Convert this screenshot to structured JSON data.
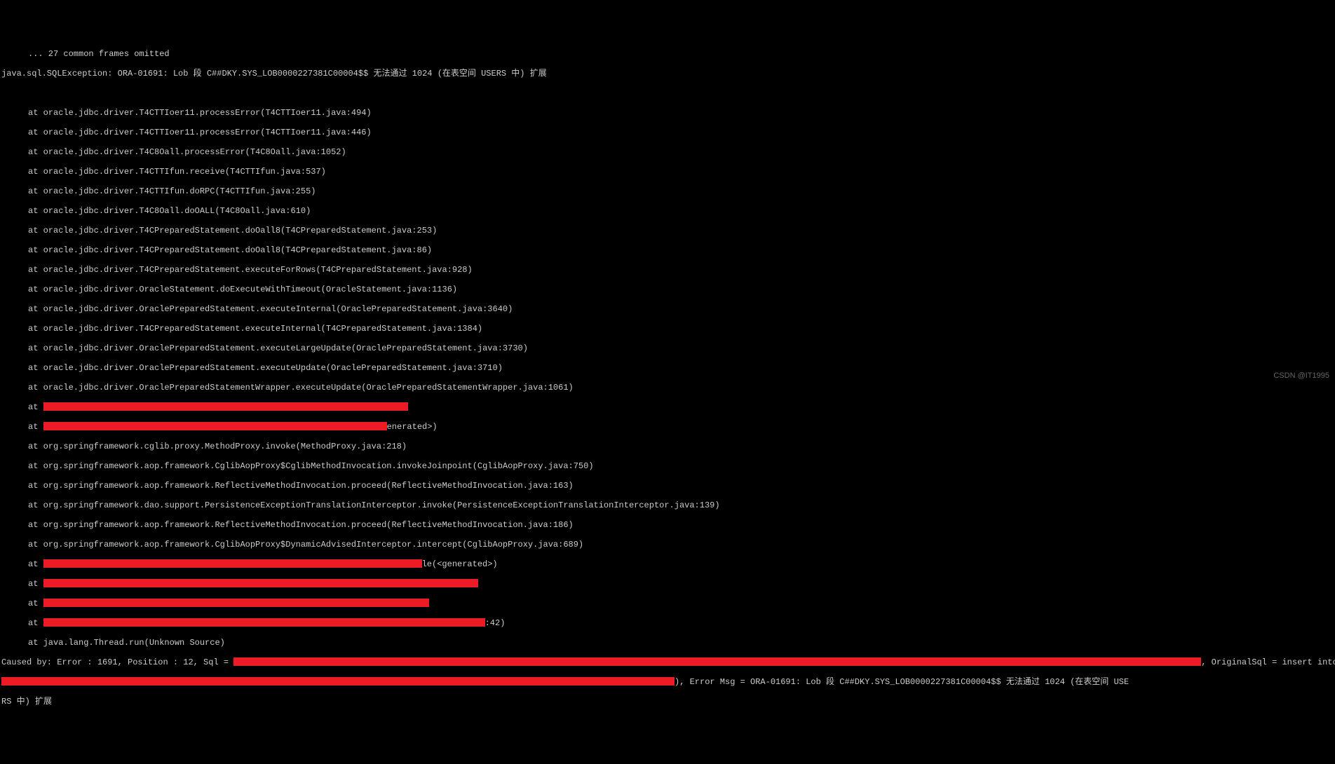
{
  "log": {
    "line00": "... 27 common frames omitted",
    "line01": "java.sql.SQLException: ORA-01691: Lob 段 C##DKY.SYS_LOB0000227381C00004$$ 无法通过 1024 (在表空间 USERS 中) 扩展",
    "line02": "",
    "line03": "at oracle.jdbc.driver.T4CTTIoer11.processError(T4CTTIoer11.java:494)",
    "line04": "at oracle.jdbc.driver.T4CTTIoer11.processError(T4CTTIoer11.java:446)",
    "line05": "at oracle.jdbc.driver.T4C8Oall.processError(T4C8Oall.java:1052)",
    "line06": "at oracle.jdbc.driver.T4CTTIfun.receive(T4CTTIfun.java:537)",
    "line07": "at oracle.jdbc.driver.T4CTTIfun.doRPC(T4CTTIfun.java:255)",
    "line08": "at oracle.jdbc.driver.T4C8Oall.doOALL(T4C8Oall.java:610)",
    "line09": "at oracle.jdbc.driver.T4CPreparedStatement.doOall8(T4CPreparedStatement.java:253)",
    "line10": "at oracle.jdbc.driver.T4CPreparedStatement.doOall8(T4CPreparedStatement.java:86)",
    "line11": "at oracle.jdbc.driver.T4CPreparedStatement.executeForRows(T4CPreparedStatement.java:928)",
    "line12": "at oracle.jdbc.driver.OracleStatement.doExecuteWithTimeout(OracleStatement.java:1136)",
    "line13": "at oracle.jdbc.driver.OraclePreparedStatement.executeInternal(OraclePreparedStatement.java:3640)",
    "line14": "at oracle.jdbc.driver.T4CPreparedStatement.executeInternal(T4CPreparedStatement.java:1384)",
    "line15": "at oracle.jdbc.driver.OraclePreparedStatement.executeLargeUpdate(OraclePreparedStatement.java:3730)",
    "line16": "at oracle.jdbc.driver.OraclePreparedStatement.executeUpdate(OraclePreparedStatement.java:3710)",
    "line17": "at oracle.jdbc.driver.OraclePreparedStatementWrapper.executeUpdate(OraclePreparedStatementWrapper.java:1061)",
    "line18_prefix": "at ",
    "line19_prefix": "at ",
    "line19_suffix": "enerated>)",
    "line20": "at org.springframework.cglib.proxy.MethodProxy.invoke(MethodProxy.java:218)",
    "line21": "at org.springframework.aop.framework.CglibAopProxy$CglibMethodInvocation.invokeJoinpoint(CglibAopProxy.java:750)",
    "line22": "at org.springframework.aop.framework.ReflectiveMethodInvocation.proceed(ReflectiveMethodInvocation.java:163)",
    "line23": "at org.springframework.dao.support.PersistenceExceptionTranslationInterceptor.invoke(PersistenceExceptionTranslationInterceptor.java:139)",
    "line24": "at org.springframework.aop.framework.ReflectiveMethodInvocation.proceed(ReflectiveMethodInvocation.java:186)",
    "line25": "at org.springframework.aop.framework.CglibAopProxy$DynamicAdvisedInterceptor.intercept(CglibAopProxy.java:689)",
    "line26_prefix": "at ",
    "line26_suffix": "le(<generated>)",
    "line27_prefix": "at ",
    "line28_prefix": "at ",
    "line29_prefix": "at ",
    "line29_suffix": ":42)",
    "line30": "at java.lang.Thread.run(Unknown Source)",
    "line31_prefix": "Caused by: Error : 1691, Position : 12, Sql = ",
    "line31_suffix": ", OriginalSql = insert into BJ",
    "line32_prefix": "",
    "line32_suffix": "), Error Msg = ORA-01691: Lob 段 C##DKY.SYS_LOB0000227381C00004$$ 无法通过 1024 (在表空间 USE",
    "line33": "RS 中) 扩展"
  },
  "watermark": "CSDN @IT1995"
}
